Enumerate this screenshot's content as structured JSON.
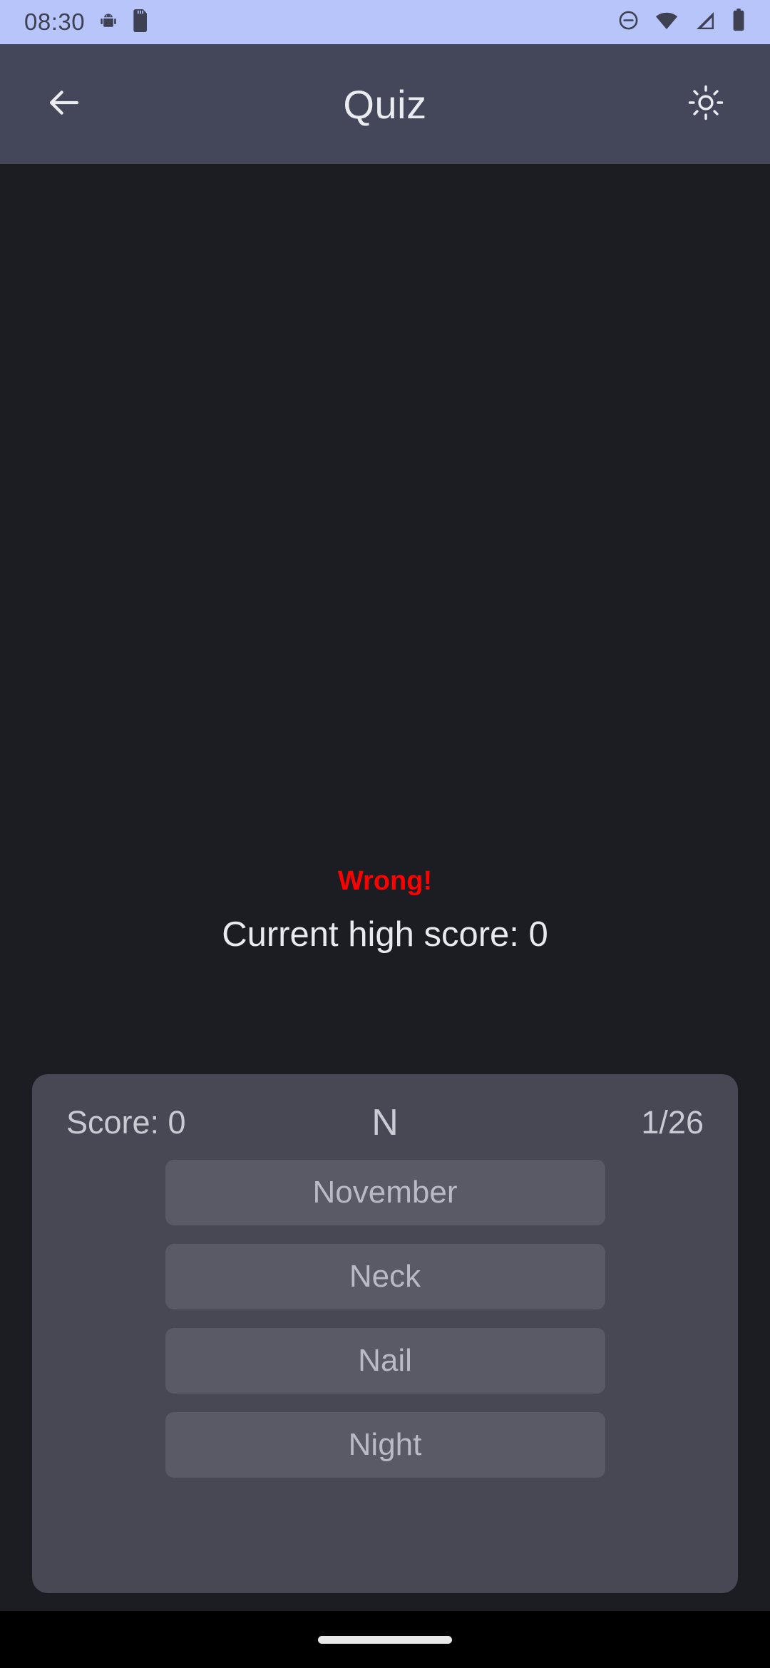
{
  "status_bar": {
    "time": "08:30",
    "left_icons": [
      "android-robot-icon",
      "sd-card-icon"
    ],
    "right_icons": [
      "do-not-disturb-icon",
      "wifi-icon",
      "cellular-signal-icon",
      "battery-icon"
    ],
    "background_color": "#b8c5fb",
    "foreground_color": "#3d4152"
  },
  "app_bar": {
    "title": "Quiz",
    "back_icon": "arrow-left-icon",
    "theme_toggle_icon": "sun-brightness-icon",
    "background_color": "#434759"
  },
  "feedback": {
    "result_text": "Wrong!",
    "result_color": "#ff0000",
    "high_score_text": "Current high score: 0"
  },
  "quiz_card": {
    "score_label": "Score: 0",
    "question_letter": "N",
    "progress_label": "1/26",
    "card_color": "#474854",
    "option_color": "#595a66",
    "options": [
      {
        "label": "November"
      },
      {
        "label": "Neck"
      },
      {
        "label": "Nail"
      },
      {
        "label": "Night"
      }
    ]
  },
  "nav_bar": {
    "gesture_pill": "home-indicator"
  },
  "theme": {
    "page_background": "#1c1d22",
    "text_primary": "#e9eaee",
    "text_muted": "#b9bac3"
  }
}
